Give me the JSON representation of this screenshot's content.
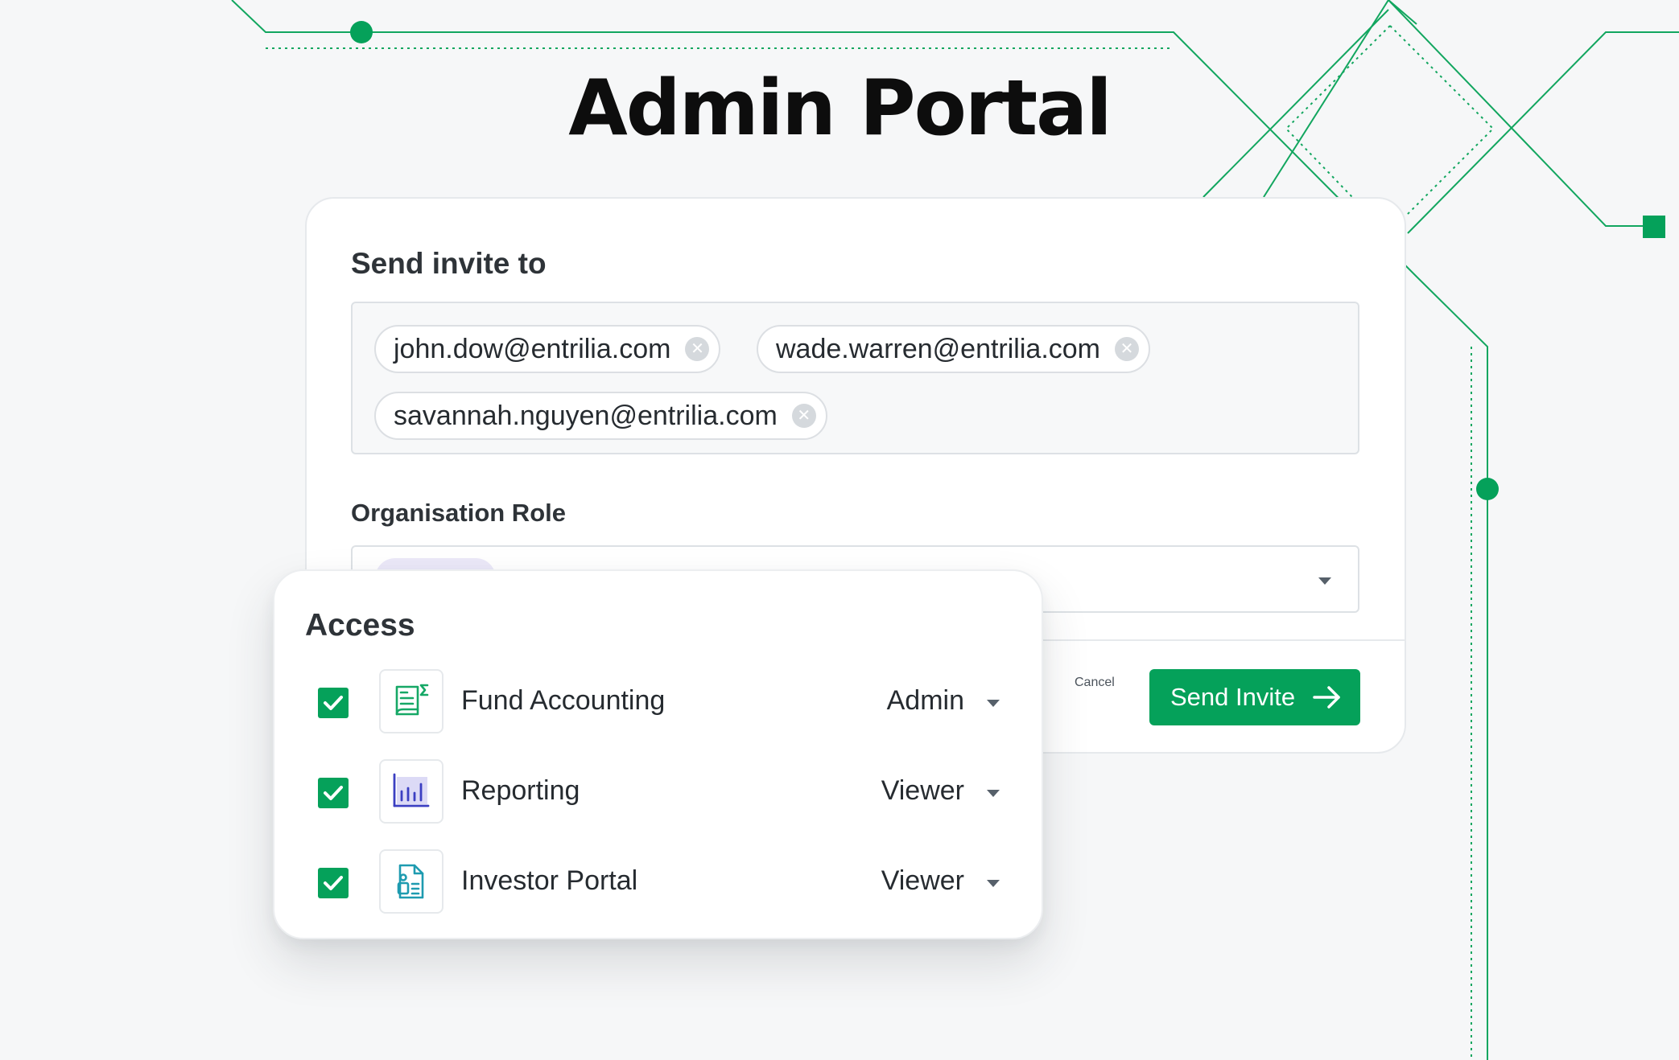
{
  "page": {
    "title": "Admin Portal"
  },
  "colors": {
    "accent": "#05a15a",
    "card_border": "#e6e9ec",
    "role_chip": "#ebe8f8"
  },
  "invite": {
    "send_to_label": "Send invite to",
    "recipients": [
      {
        "email": "john.dow@entrilia.com"
      },
      {
        "email": "wade.warren@entrilia.com"
      },
      {
        "email": "savannah.nguyen@entrilia.com"
      }
    ],
    "org_role_label": "Organisation Role",
    "cancel_label": "Cancel",
    "send_label": "Send Invite"
  },
  "access": {
    "title": "Access",
    "rows": [
      {
        "name": "Fund Accounting",
        "role": "Admin",
        "checked": true,
        "icon": "ledger-sigma-icon"
      },
      {
        "name": "Reporting",
        "role": "Viewer",
        "checked": true,
        "icon": "bar-chart-icon"
      },
      {
        "name": "Investor Portal",
        "role": "Viewer",
        "checked": true,
        "icon": "investor-document-icon"
      }
    ]
  }
}
